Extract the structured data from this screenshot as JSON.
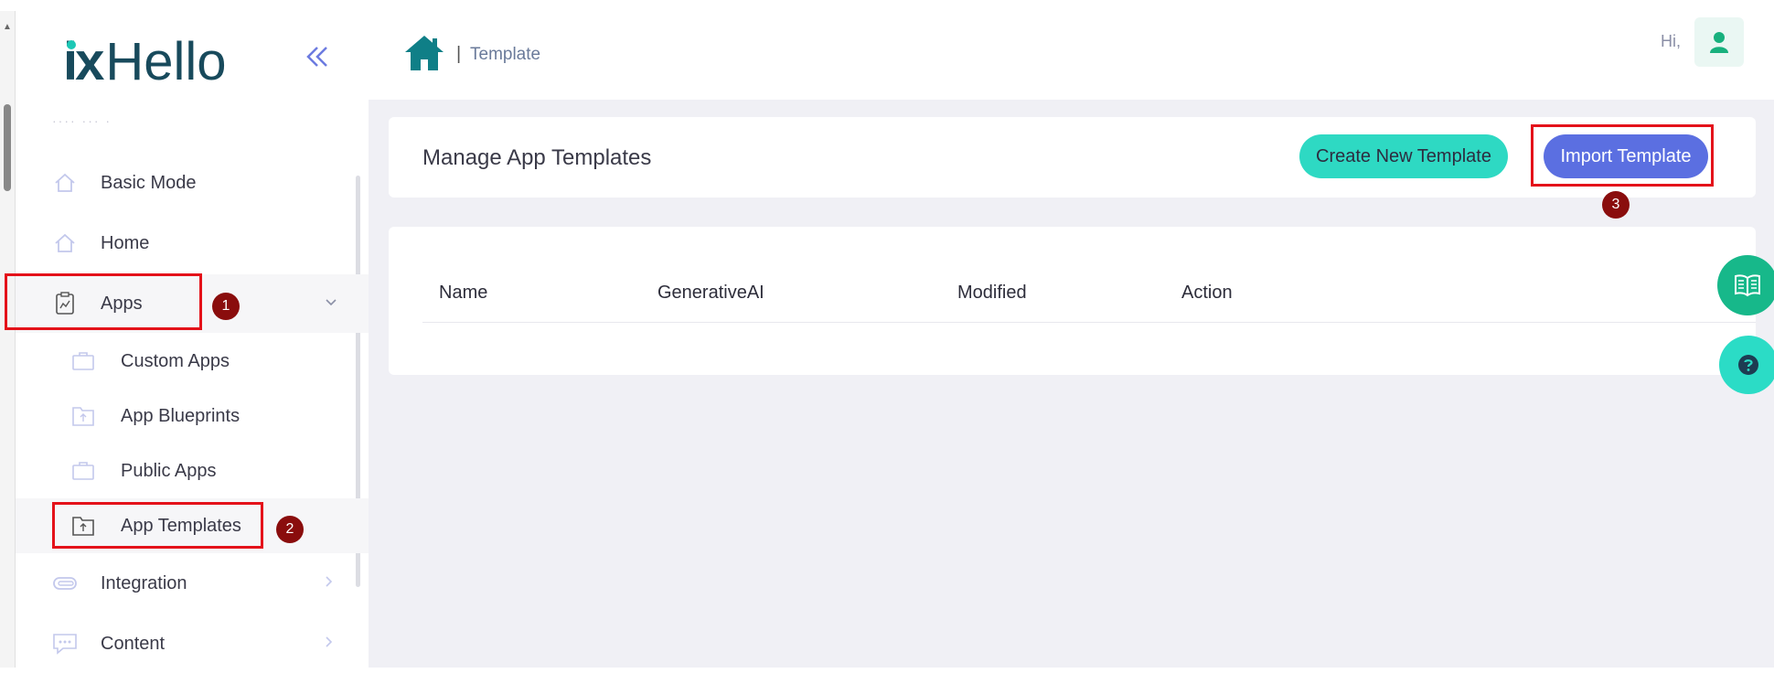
{
  "logo": {
    "ix": "ix",
    "hello": "Hello"
  },
  "sidebar": {
    "dots": "···· ··· ·",
    "items": [
      {
        "label": "Basic Mode",
        "icon": "home-outline-icon"
      },
      {
        "label": "Home",
        "icon": "home-outline-icon"
      },
      {
        "label": "Apps",
        "icon": "clipboard-chart-icon",
        "expanded": true
      },
      {
        "label": "Integration",
        "icon": "paperclip-icon"
      },
      {
        "label": "Content",
        "icon": "chat-bubble-icon"
      }
    ],
    "apps_sub": [
      {
        "label": "Custom Apps",
        "icon": "briefcase-icon"
      },
      {
        "label": "App Blueprints",
        "icon": "folder-upload-icon"
      },
      {
        "label": "Public Apps",
        "icon": "briefcase-icon"
      },
      {
        "label": "App Templates",
        "icon": "folder-upload-icon",
        "active": true
      }
    ]
  },
  "header": {
    "breadcrumb_sep": "|",
    "breadcrumb": "Template",
    "greeting": "Hi,"
  },
  "main": {
    "title": "Manage App Templates",
    "create_button": "Create New Template",
    "import_button": "Import Template",
    "table": {
      "columns": [
        "Name",
        "GenerativeAI",
        "Modified",
        "Action"
      ]
    }
  },
  "annotations": {
    "step1": "1",
    "step2": "2",
    "step3": "3"
  },
  "colors": {
    "brand_dark": "#184a5c",
    "brand_teal": "#1cc7b5",
    "accent_blue": "#5b6fe1",
    "accent_teal": "#2ed9c3",
    "highlight_red": "#e4121a",
    "badge_red": "#8a0d0d"
  }
}
